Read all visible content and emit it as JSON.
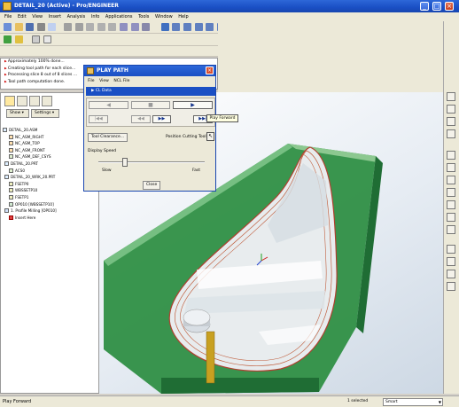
{
  "window": {
    "title": "DETAIL_20 (Active) - Pro/ENGINEER"
  },
  "menu": [
    "File",
    "Edit",
    "View",
    "Insert",
    "Analysis",
    "Info",
    "Applications",
    "Tools",
    "Window",
    "Help"
  ],
  "messages": [
    "Approximately 100% done...",
    "Creating tool path for each slice...",
    "Processing slice 8 out of 8 slices ...",
    "Tool path computation done."
  ],
  "left_panel": {
    "show_label": "Show ▾",
    "settings_label": "Settings ▾"
  },
  "tree": [
    "DETAIL_20.ASM",
    "NC_ASM_RIGHT",
    "NC_ASM_TOP",
    "NC_ASM_FRONT",
    "NC_ASM_DEF_CSYS",
    "DETAIL_20.PRT",
    "ACS0",
    "DETAIL_20_WRK_20.PRT",
    "FSETP0",
    "WBSSETP10",
    "FSETP1",
    "OP010 [WBSSETP10]",
    "1. Profile Milling [OP010]",
    "Insert Here"
  ],
  "dialog": {
    "title": "PLAY PATH",
    "menu": [
      "File",
      "View",
      "NCL File"
    ],
    "clock": "CL Data",
    "tool_clearance": "Tool Clearance...",
    "position_label": "Position Cutting Tool",
    "display_speed": "Display Speed",
    "slow": "Slow",
    "fast": "Fast",
    "close": "Close",
    "speed_level": 0.25
  },
  "tooltip": "Play Forward",
  "statusbar": {
    "message": "Play Forward",
    "selected": "1 selected",
    "filter": "Smart"
  }
}
